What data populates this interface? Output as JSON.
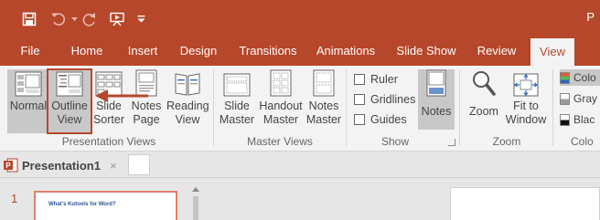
{
  "window": {
    "title_partial": "P"
  },
  "colors": {
    "accent": "#b7472a",
    "ribbon_bg": "#f3f3f3",
    "selected_bg": "#c8c8c8",
    "arrow": "#b7472a"
  },
  "quick_access": [
    {
      "icon": "save-icon"
    },
    {
      "icon": "undo-icon"
    },
    {
      "icon": "redo-icon"
    },
    {
      "icon": "present-icon"
    },
    {
      "icon": "customize-qat-icon"
    }
  ],
  "tabs": [
    "File",
    "Home",
    "Insert",
    "Design",
    "Transitions",
    "Animations",
    "Slide Show",
    "Review",
    "View"
  ],
  "active_tab": "View",
  "ribbon": {
    "presentation_views": {
      "label": "Presentation Views",
      "buttons": [
        {
          "lines": [
            "Normal"
          ],
          "state": "selected"
        },
        {
          "lines": [
            "Outline",
            "View"
          ],
          "state": "highlighted"
        },
        {
          "lines": [
            "Slide",
            "Sorter"
          ]
        },
        {
          "lines": [
            "Notes",
            "Page"
          ]
        },
        {
          "lines": [
            "Reading",
            "View"
          ]
        }
      ]
    },
    "master_views": {
      "label": "Master Views",
      "buttons": [
        {
          "lines": [
            "Slide",
            "Master"
          ]
        },
        {
          "lines": [
            "Handout",
            "Master"
          ]
        },
        {
          "lines": [
            "Notes",
            "Master"
          ]
        }
      ]
    },
    "show": {
      "label": "Show",
      "checkboxes": [
        {
          "label": "Ruler",
          "checked": false
        },
        {
          "label": "Gridlines",
          "checked": false
        },
        {
          "label": "Guides",
          "checked": false
        }
      ],
      "notes_button": {
        "label": "Notes",
        "state": "selected"
      }
    },
    "zoom": {
      "label": "Zoom",
      "buttons": [
        {
          "lines": [
            "Zoom"
          ]
        },
        {
          "lines": [
            "Fit to",
            "Window"
          ]
        }
      ]
    },
    "color": {
      "label": "Colo",
      "options": [
        {
          "label": "Colo",
          "swatch": "#e05a3a"
        },
        {
          "label": "Gray",
          "swatch": "#9a9a9a"
        },
        {
          "label": "Blac",
          "swatch": "#111111"
        }
      ]
    }
  },
  "document": {
    "tab_name": "Presentation1",
    "close_glyph": "×"
  },
  "slides": [
    {
      "number": "1",
      "thumb_title": "What's Kutools for Word?"
    }
  ]
}
